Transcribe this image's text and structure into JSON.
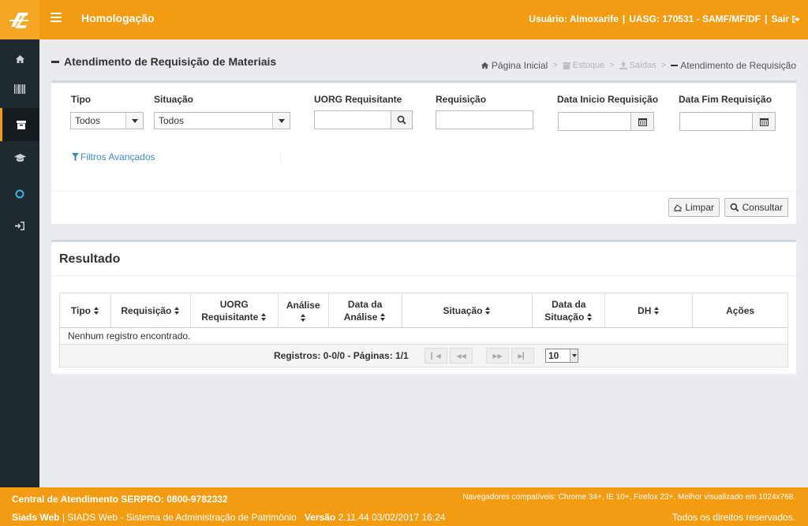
{
  "header": {
    "title": "Homologação",
    "user_label": "Usuário: Almoxarife",
    "uasg_label": "UASG: 170531 - SAMF/MF/DF",
    "logout_label": "Sair"
  },
  "sidebar": {
    "items": [
      {
        "name": "home-icon"
      },
      {
        "name": "barcode-icon"
      },
      {
        "name": "archive-icon",
        "active": true
      },
      {
        "name": "graduation-cap-icon"
      },
      {
        "name": "circle-icon"
      },
      {
        "name": "sign-in-icon"
      }
    ]
  },
  "page": {
    "title": "Atendimento de Requisição de Materiais",
    "breadcrumb": {
      "home": "Página Inicial",
      "estoque": "Estoque",
      "saidas": "Saídas",
      "current": "Atendimento de Requisição"
    }
  },
  "filters": {
    "tipo_label": "Tipo",
    "tipo_value": "Todos",
    "situacao_label": "Situação",
    "situacao_value": "Todos",
    "uorg_label": "UORG Requisitante",
    "uorg_value": "",
    "requisicao_label": "Requisição",
    "requisicao_value": "",
    "data_inicio_label": "Data Inicio Requisição",
    "data_inicio_value": "",
    "data_fim_label": "Data Fim Requisição",
    "data_fim_value": "",
    "advanced_label": "Filtros Avançados",
    "clear_label": "Limpar",
    "search_label": "Consultar"
  },
  "results": {
    "title": "Resultado",
    "columns": [
      {
        "line1": "Tipo",
        "line2": ""
      },
      {
        "line1": "Requisição",
        "line2": ""
      },
      {
        "line1": "UORG",
        "line2": "Requisitante"
      },
      {
        "line1": "Análise",
        "line2": ""
      },
      {
        "line1": "Data da",
        "line2": "Análise"
      },
      {
        "line1": "Situação",
        "line2": ""
      },
      {
        "line1": "Data da",
        "line2": "Situação"
      },
      {
        "line1": "DH",
        "line2": ""
      },
      {
        "line1": "Ações",
        "line2": ""
      }
    ],
    "empty_message": "Nenhum registro encontrado.",
    "pager_text": "Registros: 0-0/0 - Páginas: 1/1",
    "rows_per_page": "10"
  },
  "footer": {
    "support": "Central de Atendimento SERPRO: 0800-9782332",
    "browsers": "Navegadores compatíveis: Chrome 34+, IE 10+, Firefox 23+. Melhor visualizado em 1024x768.",
    "app_short": "Siads Web",
    "app_full": "| SIADS Web - Sistema de Administração de Patrimônio",
    "version_label": "Versão",
    "version_value": "2.11.44 03/02/2017 16:24",
    "rights": "Todos os direitos reservados."
  },
  "colors": {
    "brand": "#f39c12",
    "sidebar": "#1f2a2f",
    "link": "#3c8dbc"
  }
}
